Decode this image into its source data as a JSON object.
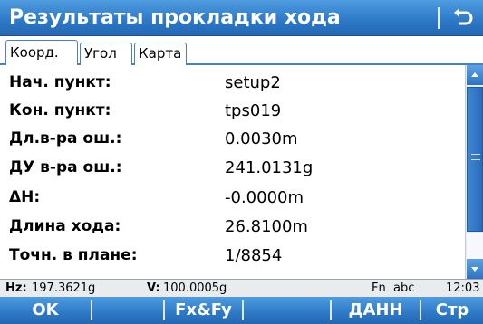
{
  "window": {
    "title": "Результаты прокладки хода"
  },
  "tabs": [
    {
      "label": "Коорд.",
      "active": true
    },
    {
      "label": "Угол",
      "active": false
    },
    {
      "label": "Карта",
      "active": false
    }
  ],
  "rows": [
    {
      "label": "Нач. пункт:",
      "value": "setup2"
    },
    {
      "label": "Кон. пункт:",
      "value": "tps019"
    },
    {
      "label": "Дл.в-ра ош.:",
      "value": "0.0030m"
    },
    {
      "label": "ДУ в-ра ош.:",
      "value": "241.0131g"
    },
    {
      "label": "ΔH:",
      "value": "-0.0000m"
    },
    {
      "label": "Длина хода:",
      "value": "26.8100m"
    },
    {
      "label": "Точн. в плане:",
      "value": "1/8854"
    }
  ],
  "status": {
    "hz_label": "Hz:",
    "hz_value": "197.3621g",
    "v_label": "V:",
    "v_value": "100.0005g",
    "fn": "Fn",
    "input_mode": "abc",
    "time": "12:03"
  },
  "softkeys": {
    "f1": "OK",
    "f2": "",
    "f3": "Fx&Fy",
    "f4": "",
    "f5": "ДАНН",
    "f6": "Стр"
  },
  "colors": {
    "title_bg": "#2d78c6",
    "accent": "#4a7fc1",
    "status_bg": "#e9ecef"
  },
  "icons": {
    "back": "back-arrow-icon",
    "scroll_up": "arrow-up-icon",
    "scroll_down": "arrow-down-icon"
  }
}
